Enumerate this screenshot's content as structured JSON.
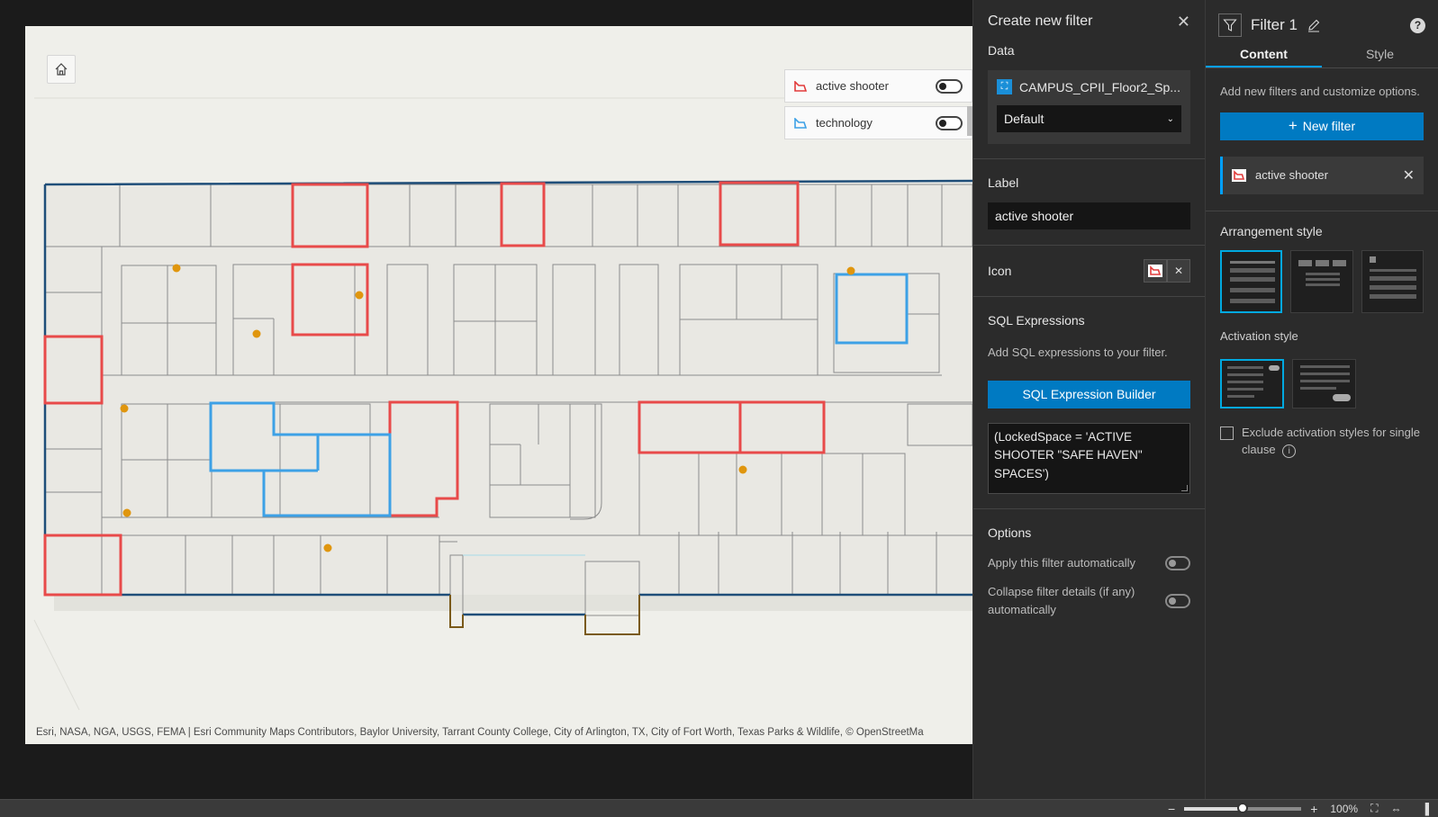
{
  "map": {
    "legend": [
      {
        "label": "active shooter",
        "color": "#e23b3b"
      },
      {
        "label": "technology",
        "color": "#3da1e6"
      }
    ],
    "attribution": "Esri, NASA, NGA, USGS, FEMA | Esri Community Maps Contributors, Baylor University, Tarrant County College, City of Arlington, TX, City of Fort Worth, Texas Parks & Wildlife, © OpenStreetMa"
  },
  "create_panel": {
    "title": "Create new filter",
    "data_section": "Data",
    "layer_name": "CAMPUS_CPII_Floor2_Sp...",
    "view_select": "Default",
    "label_section": "Label",
    "label_value": "active shooter",
    "icon_section": "Icon",
    "sql_section": "SQL Expressions",
    "sql_hint": "Add SQL expressions to your filter.",
    "sql_builder_button": "SQL Expression Builder",
    "sql_expression": "(LockedSpace = 'ACTIVE SHOOTER \"SAFE HAVEN\" SPACES')",
    "options_section": "Options",
    "option_apply_auto": "Apply this filter automatically",
    "option_collapse": "Collapse filter details (if any) automatically"
  },
  "filter_panel": {
    "title": "Filter 1",
    "help": "?",
    "tab_content": "Content",
    "tab_style": "Style",
    "description": "Add new filters and customize options.",
    "new_filter_button": "New filter",
    "filter_items": [
      {
        "label": "active shooter"
      }
    ],
    "arrangement_title": "Arrangement style",
    "activation_title": "Activation style",
    "exclude_label": "Exclude activation styles for single clause",
    "accent_color": "#00a0ff"
  },
  "status_bar": {
    "zoom": "100%",
    "zoom_fraction": 0.5
  }
}
